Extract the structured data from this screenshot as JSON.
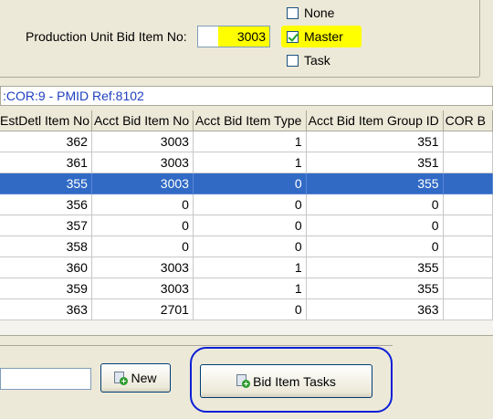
{
  "production_unit": {
    "label": "Production Unit Bid Item No:",
    "value": "3003"
  },
  "options": [
    {
      "label": "None",
      "checked": false
    },
    {
      "label": "Master",
      "checked": true
    },
    {
      "label": "Task",
      "checked": false
    }
  ],
  "reference": ":COR:9 - PMID Ref:8102",
  "grid": {
    "columns": [
      "EstDetl Item No",
      "Acct Bid Item No",
      "Acct Bid Item Type",
      "Acct Bid Item Group ID",
      "COR B"
    ],
    "rows": [
      [
        "362",
        "3003",
        "1",
        "351",
        ""
      ],
      [
        "361",
        "3003",
        "1",
        "351",
        ""
      ],
      [
        "355",
        "3003",
        "0",
        "355",
        ""
      ],
      [
        "356",
        "0",
        "0",
        "0",
        ""
      ],
      [
        "357",
        "0",
        "0",
        "0",
        ""
      ],
      [
        "358",
        "0",
        "0",
        "0",
        ""
      ],
      [
        "360",
        "3003",
        "1",
        "355",
        ""
      ],
      [
        "359",
        "3003",
        "1",
        "355",
        ""
      ],
      [
        "363",
        "2701",
        "0",
        "363",
        ""
      ]
    ],
    "selected_row": 2
  },
  "buttons": {
    "new": "New",
    "bid_item_tasks": "Bid Item Tasks"
  },
  "colors": {
    "highlight": "#ffff00",
    "selection": "#316ac5",
    "annotation": "#0b1fd6"
  }
}
